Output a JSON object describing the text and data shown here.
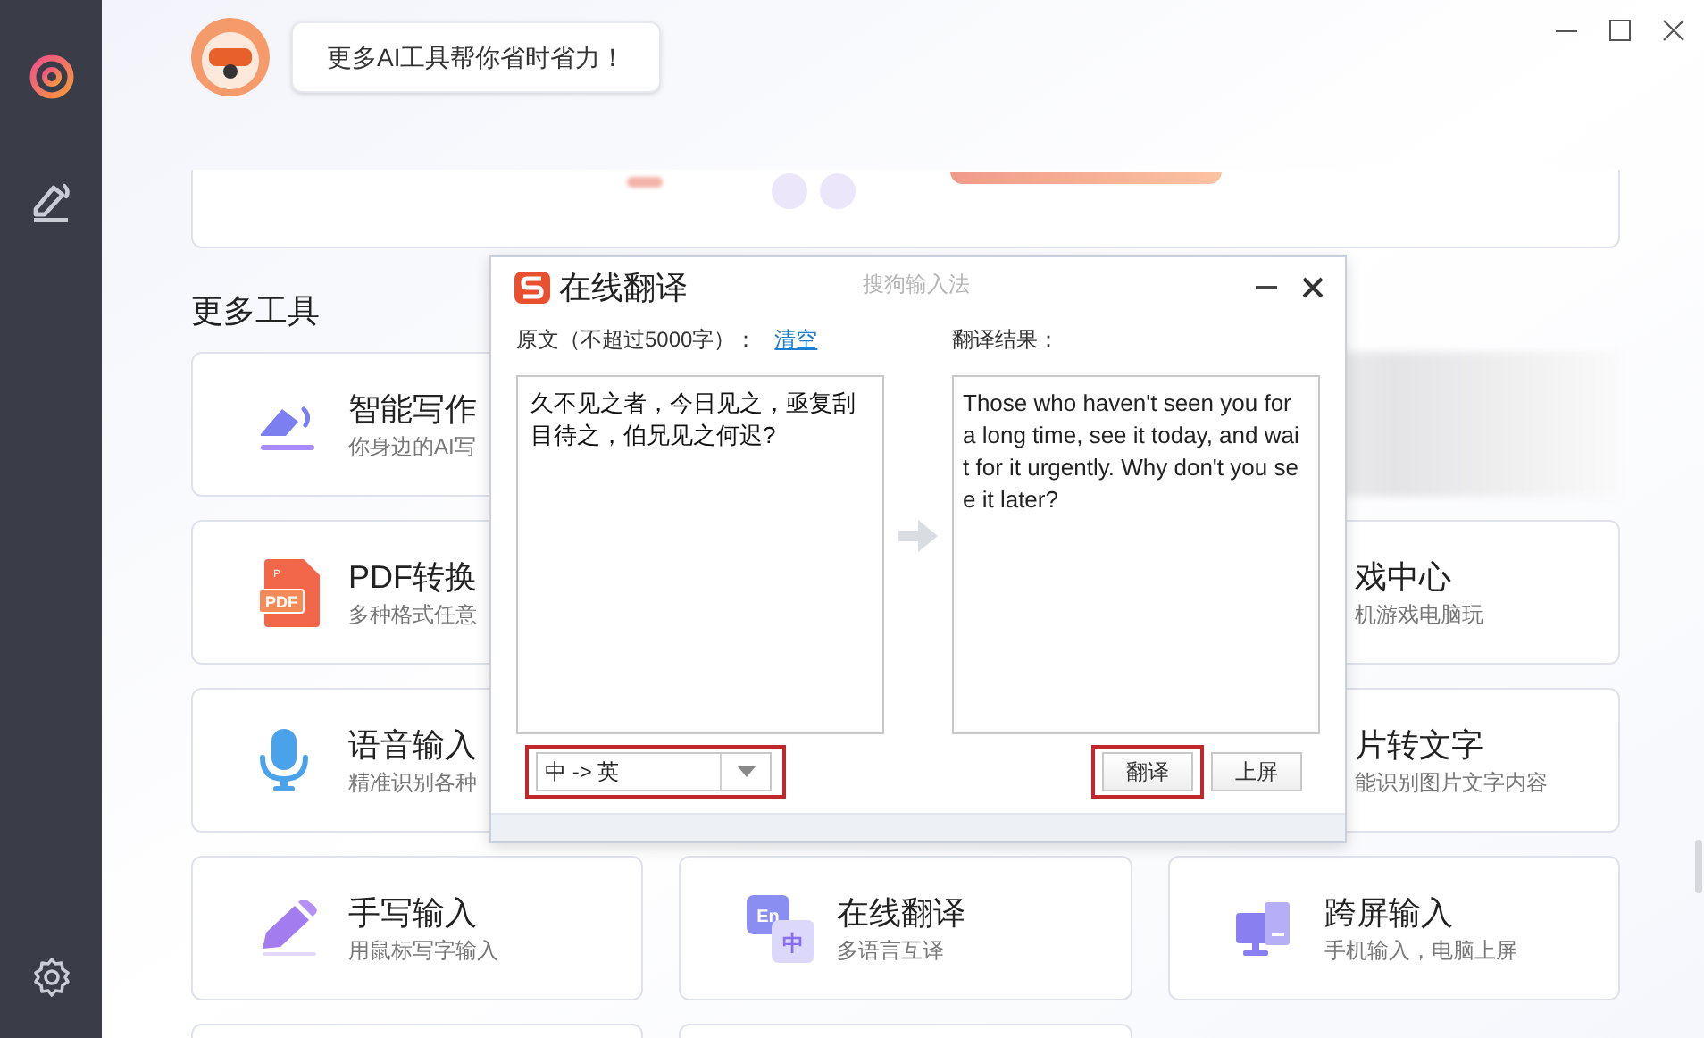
{
  "sidebar": {
    "items": [
      {
        "kind": "target",
        "selected": true
      },
      {
        "kind": "pen",
        "selected": false
      }
    ]
  },
  "assistant": {
    "message": "更多AI工具帮你省时省力！"
  },
  "section_title": "更多工具",
  "tools": [
    {
      "kind": "pen",
      "title": "智能写作",
      "subtitle": "你身边的AI写"
    },
    {
      "kind": "empty"
    },
    {
      "kind": "blurred"
    },
    {
      "kind": "pdf",
      "icon_labels": [
        "P",
        "PDF"
      ],
      "title": "PDF转换",
      "subtitle": "多种格式任意"
    },
    {
      "kind": "empty"
    },
    {
      "kind": "plain",
      "title": "戏中心",
      "subtitle": "机游戏电脑玩"
    },
    {
      "kind": "mic",
      "title": "语音输入",
      "subtitle": "精准识别各种"
    },
    {
      "kind": "empty"
    },
    {
      "kind": "plain",
      "title": "片转文字",
      "subtitle": "能识别图片文字内容"
    },
    {
      "kind": "handwrite",
      "title": "手写输入",
      "subtitle": "用鼠标写字输入"
    },
    {
      "kind": "translate",
      "icon_labels": [
        "En",
        "中"
      ],
      "title": "在线翻译",
      "subtitle": "多语言互译"
    },
    {
      "kind": "screen",
      "title": "跨屏输入",
      "subtitle": "手机输入，电脑上屏"
    },
    {
      "kind": "empty"
    },
    {
      "kind": "empty"
    }
  ],
  "dialog": {
    "title": "在线翻译",
    "brand": "搜狗输入法",
    "source_label": "原文（不超过5000字）：",
    "clear_link": "清空",
    "result_label": "翻译结果：",
    "source_text": "久不见之者，今日见之，亟复刮目待之，伯兄见之何迟?",
    "result_text": "Those who haven't seen you for a long time, see it today, and wait for it urgently. Why don't you see it later?",
    "direction": "中 -> 英",
    "buttons": [
      {
        "label": "翻译",
        "highlighted": true
      },
      {
        "label": "上屏",
        "highlighted": false
      }
    ]
  }
}
